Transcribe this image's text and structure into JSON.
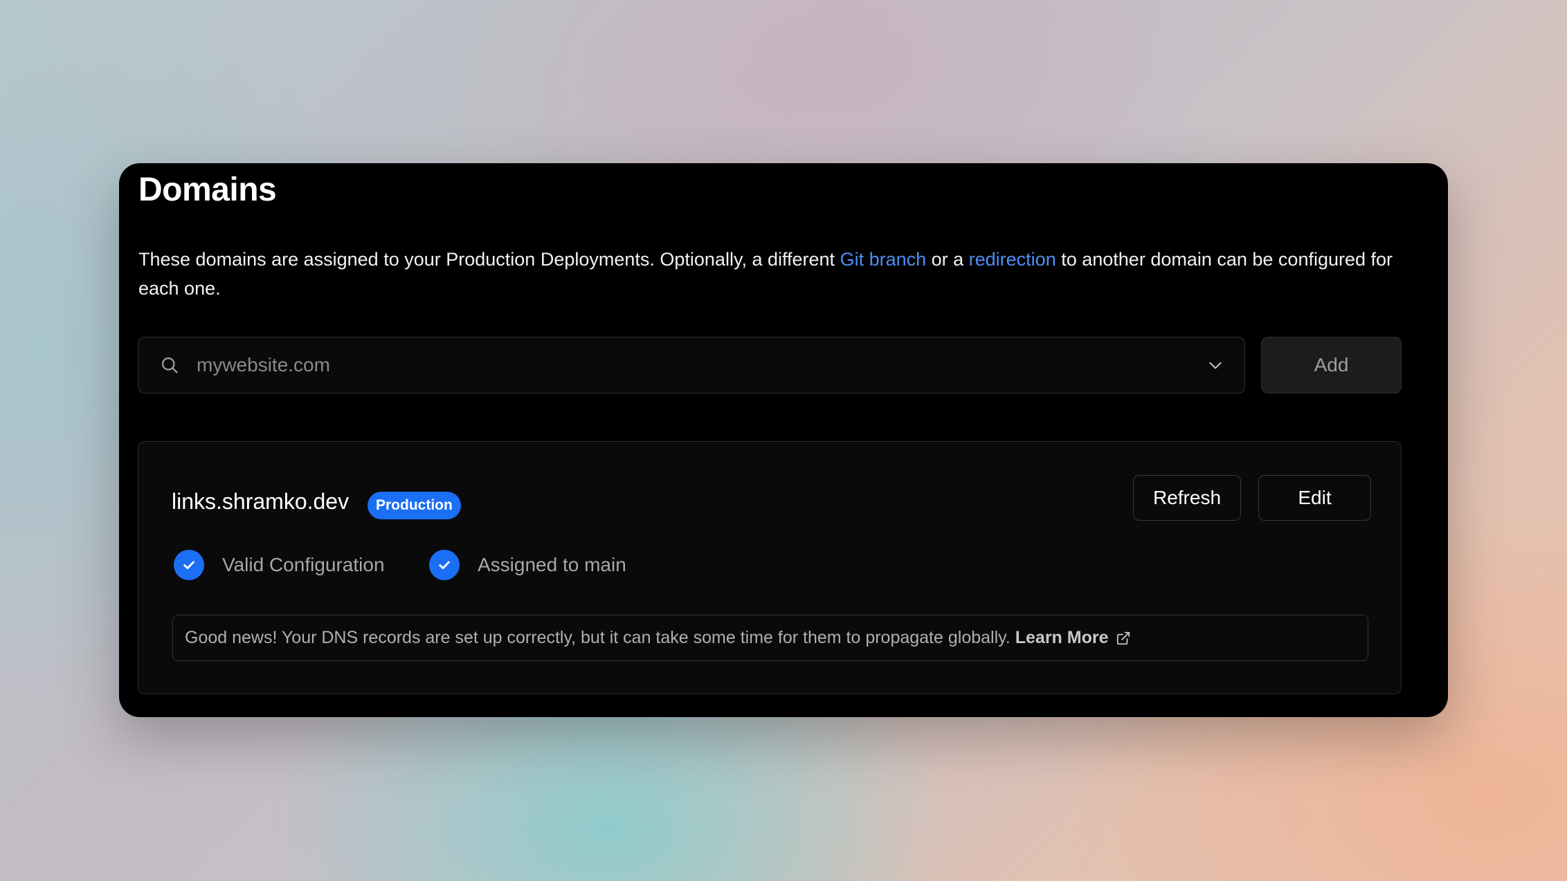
{
  "header": {
    "title": "Domains"
  },
  "description": {
    "text_before": "These domains are assigned to your Production Deployments. Optionally, a different ",
    "link_git_branch": "Git branch",
    "text_middle": " or a ",
    "link_redirection": "redirection",
    "text_after": " to another domain can be configured for each one."
  },
  "search": {
    "value": "",
    "placeholder": "mywebsite.com"
  },
  "add_button": {
    "label": "Add"
  },
  "domain": {
    "name": "links.shramko.dev",
    "badge": "Production",
    "refresh_label": "Refresh",
    "edit_label": "Edit",
    "statuses": [
      {
        "label": "Valid Configuration",
        "icon": "check-icon"
      },
      {
        "label": "Assigned to main",
        "icon": "check-icon"
      }
    ],
    "notice_text": "Good news! Your DNS records are set up correctly, but it can take some time for them to propagate globally.",
    "learn_more_label": "Learn More"
  },
  "colors": {
    "accent": "#1a6ff5",
    "link": "#4f8ef7",
    "card_background": "#000000"
  }
}
